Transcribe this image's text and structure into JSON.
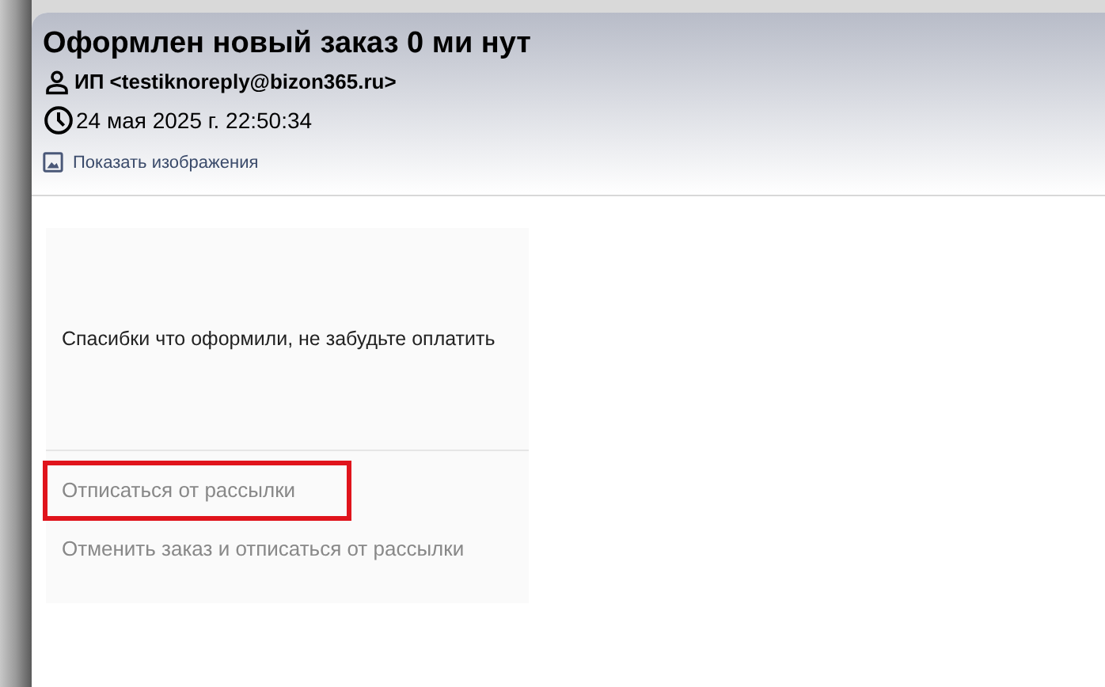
{
  "email": {
    "subject": "Оформлен новый заказ 0 ми нут",
    "sender": "ИП <testiknoreply@bizon365.ru>",
    "date": "24 мая 2025 г. 22:50:34",
    "show_images": "Показать изображения"
  },
  "body": {
    "message": "Спасибки что оформили, не забудьте оплатить",
    "links": [
      {
        "text": "Отписаться от рассылки",
        "highlighted": true
      },
      {
        "text": "Отменить заказ и отписаться от рассылки",
        "highlighted": false
      }
    ]
  }
}
